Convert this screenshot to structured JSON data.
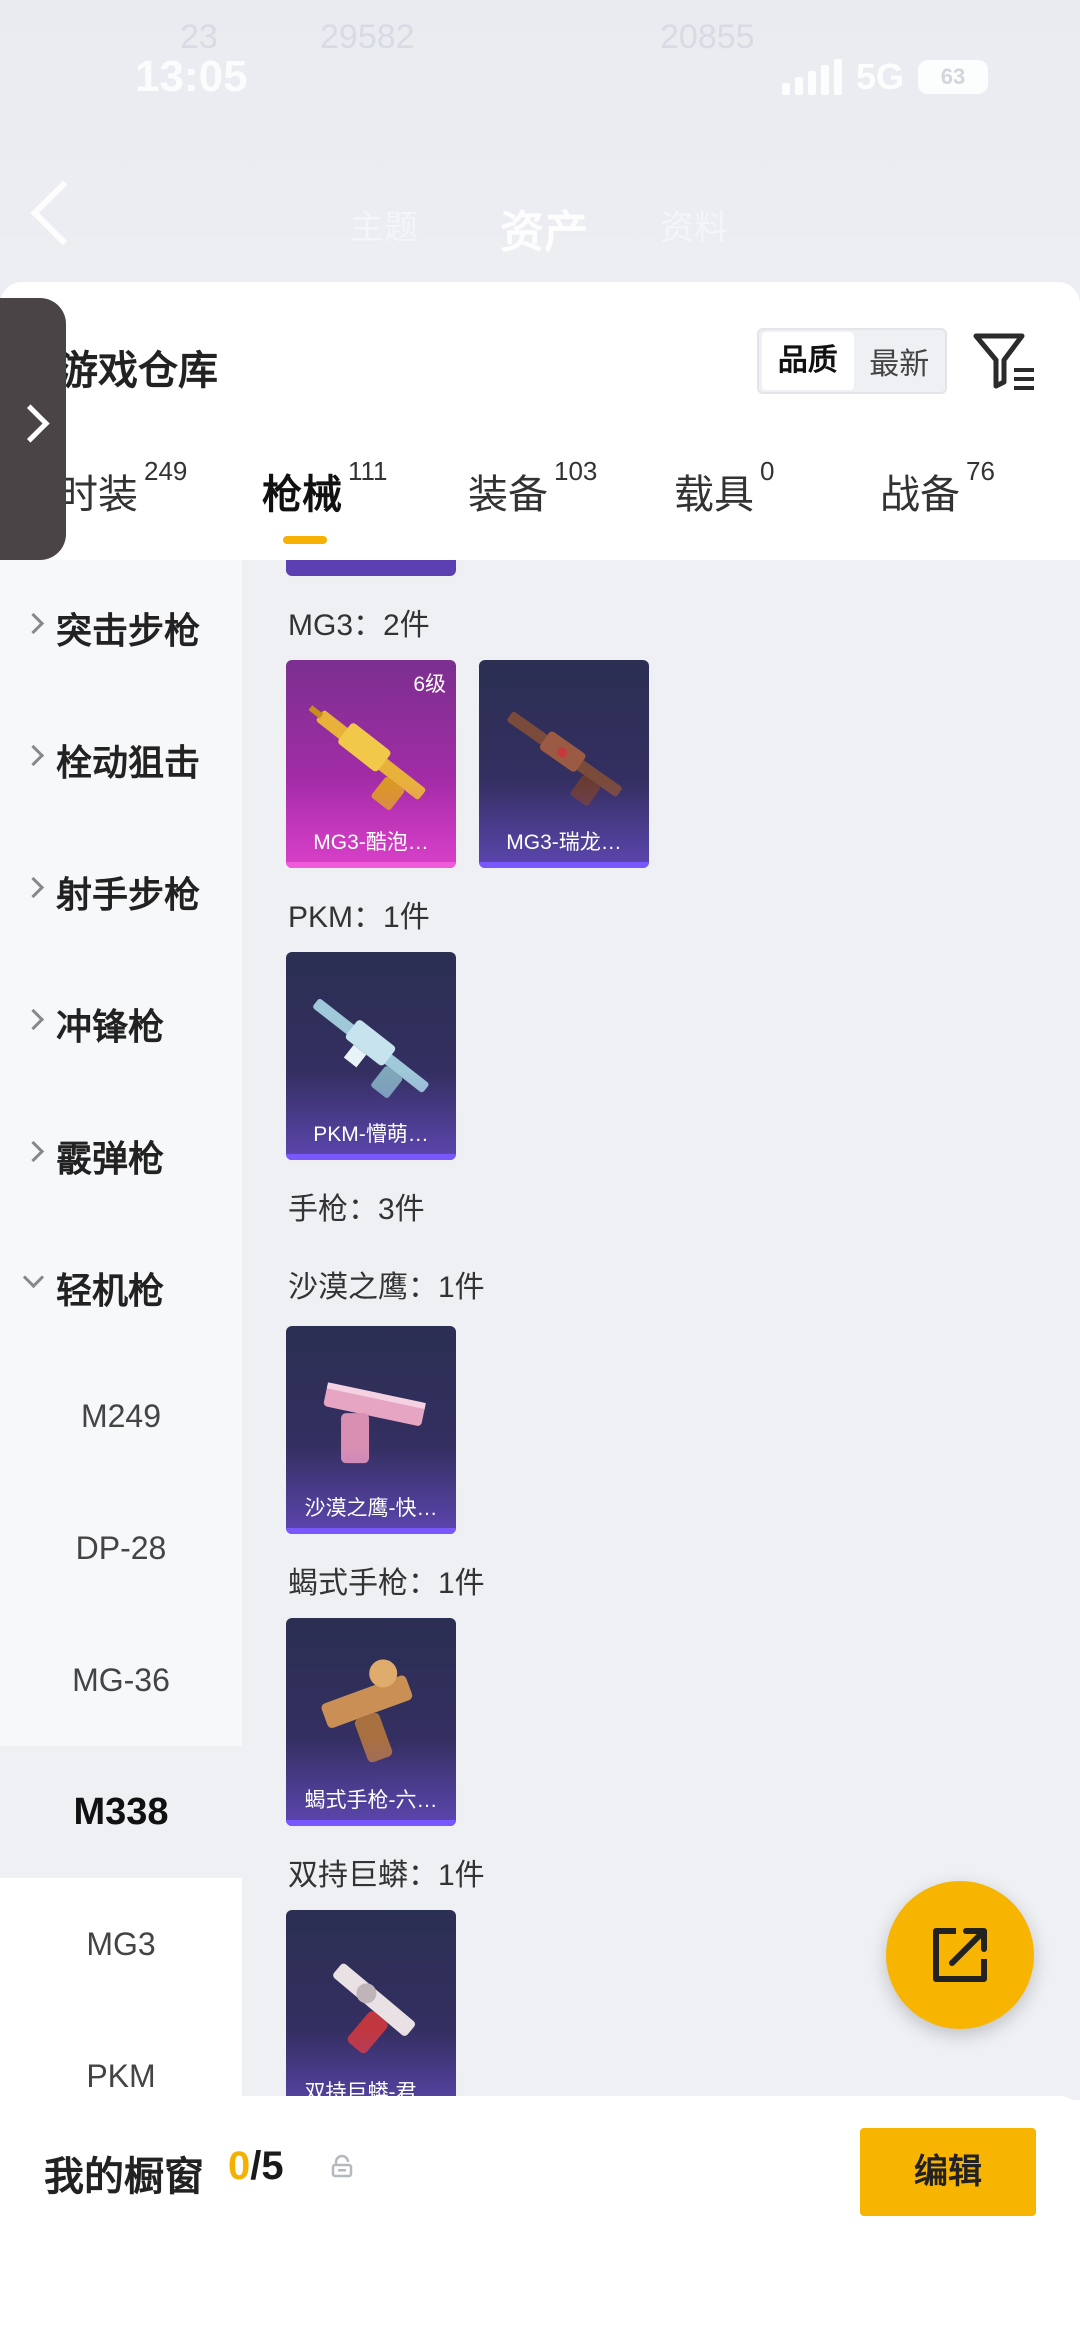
{
  "status_bar": {
    "time": "13:05",
    "network": "5G",
    "battery": "63",
    "faint_left_1": "23",
    "faint_left_2": "29582",
    "faint_mid": "20855"
  },
  "nav": {
    "title": "资产",
    "faint_left": "主题",
    "faint_right": "资料"
  },
  "warehouse": {
    "title": "游戏仓库",
    "sort_options": [
      "品质",
      "最新"
    ],
    "active_sort": "品质"
  },
  "tabs": [
    {
      "label": "时装",
      "count": "249"
    },
    {
      "label": "枪械",
      "count": "111"
    },
    {
      "label": "装备",
      "count": "103"
    },
    {
      "label": "载具",
      "count": "0"
    },
    {
      "label": "战备",
      "count": "76"
    }
  ],
  "categories": [
    {
      "label": "突击步枪",
      "expanded": false
    },
    {
      "label": "栓动狙击",
      "expanded": false
    },
    {
      "label": "射手步枪",
      "expanded": false
    },
    {
      "label": "冲锋枪",
      "expanded": false
    },
    {
      "label": "霰弹枪",
      "expanded": false
    },
    {
      "label": "轻机枪",
      "expanded": true
    }
  ],
  "subcategories": [
    "M249",
    "DP-28",
    "MG-36",
    "M338",
    "MG3",
    "PKM"
  ],
  "selected_subcategory": "M338",
  "groups": {
    "mg3": "MG3：2件",
    "pkm": "PKM：1件",
    "pistol": "手枪：3件",
    "deagle": "沙漠之鹰：1件",
    "scorpion": "蝎式手枪：1件",
    "r45": "双持巨蟒：1件"
  },
  "items": {
    "mg3_1": {
      "name": "MG3-酷泡…",
      "level": "6级"
    },
    "mg3_2": {
      "name": "MG3-瑞龙…"
    },
    "pkm_1": {
      "name": "PKM-懵萌…"
    },
    "deagle_1": {
      "name": "沙漠之鹰-快…"
    },
    "scorpion_1": {
      "name": "蝎式手枪-六…"
    },
    "r45_1": {
      "name": "双持巨蟒-君…"
    }
  },
  "showcase": {
    "title": "我的橱窗",
    "current": "0",
    "total": "/5",
    "edit_label": "编辑"
  },
  "colors": {
    "accent": "#f7b400",
    "purple_rarity": "#c02ab8",
    "blue_rarity": "#3a2f6c"
  }
}
